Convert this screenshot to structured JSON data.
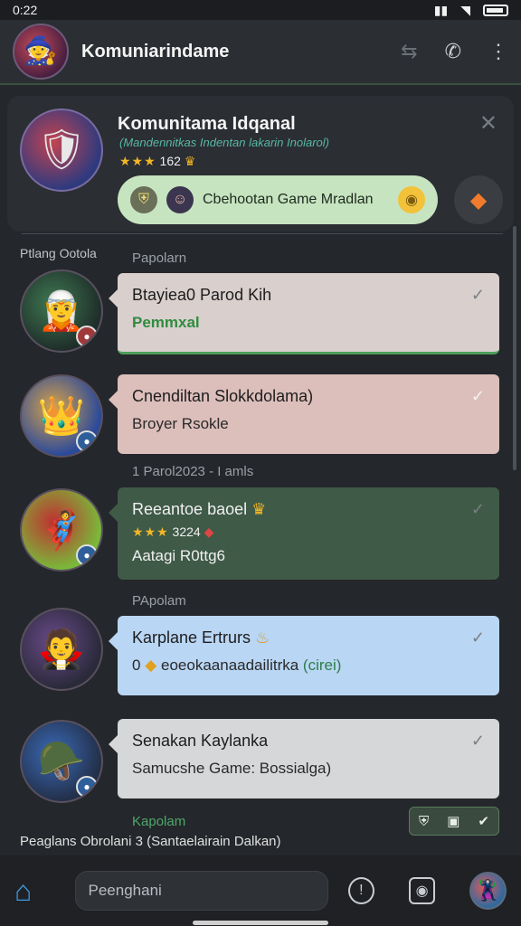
{
  "status": {
    "time": "0:22"
  },
  "header": {
    "title": "Komuniarindame",
    "avatar_icon": "hero-avatar",
    "actions": [
      "transfer-icon",
      "phone-icon",
      "more-icon"
    ]
  },
  "hero": {
    "title": "Komunitama Idqanal",
    "subtitle": "(Mandennitkas Indentan lakarin Inolarol)",
    "stars": "★★★",
    "rating_value": "162",
    "chip_label": "Cbehootan Game Mradlan",
    "close_icon": "close-icon",
    "gem_icon": "gem-icon"
  },
  "sections": {
    "left_label": "Ptlang Ootola",
    "group1": "Papolarn",
    "date_sep": "1 Parol2023 - I amls",
    "group2": "PApolam",
    "group3": "Kapolam"
  },
  "messages": [
    {
      "title": "Btayiea0 Parod Kih",
      "sub": "Pemmxal"
    },
    {
      "title": "Cnendiltan Slokkdolama)",
      "sub": "Broyer Rsokle"
    },
    {
      "title": "Reeantoe baoel",
      "stars": "★★★",
      "rating": "3224",
      "sub": "Aatagi R0ttg6"
    },
    {
      "title": "Karplane Ertrurs",
      "sub_prefix": "0",
      "sub": "eoeokaanaadailitrka",
      "sub_tag": "(cirei)"
    },
    {
      "title": "Senakan Kaylanka",
      "sub": "Samucshe Game: Bossialga)"
    }
  ],
  "footer": {
    "note": "Peaglans Obrolani 3 (Santaelairain Dalkan)"
  },
  "bottom": {
    "compose_placeholder": "Peenghani"
  },
  "colors": {
    "accent_green": "#4d9e5a",
    "accent_blue": "#3d9be6",
    "chip_bg": "#c6e4bf"
  }
}
